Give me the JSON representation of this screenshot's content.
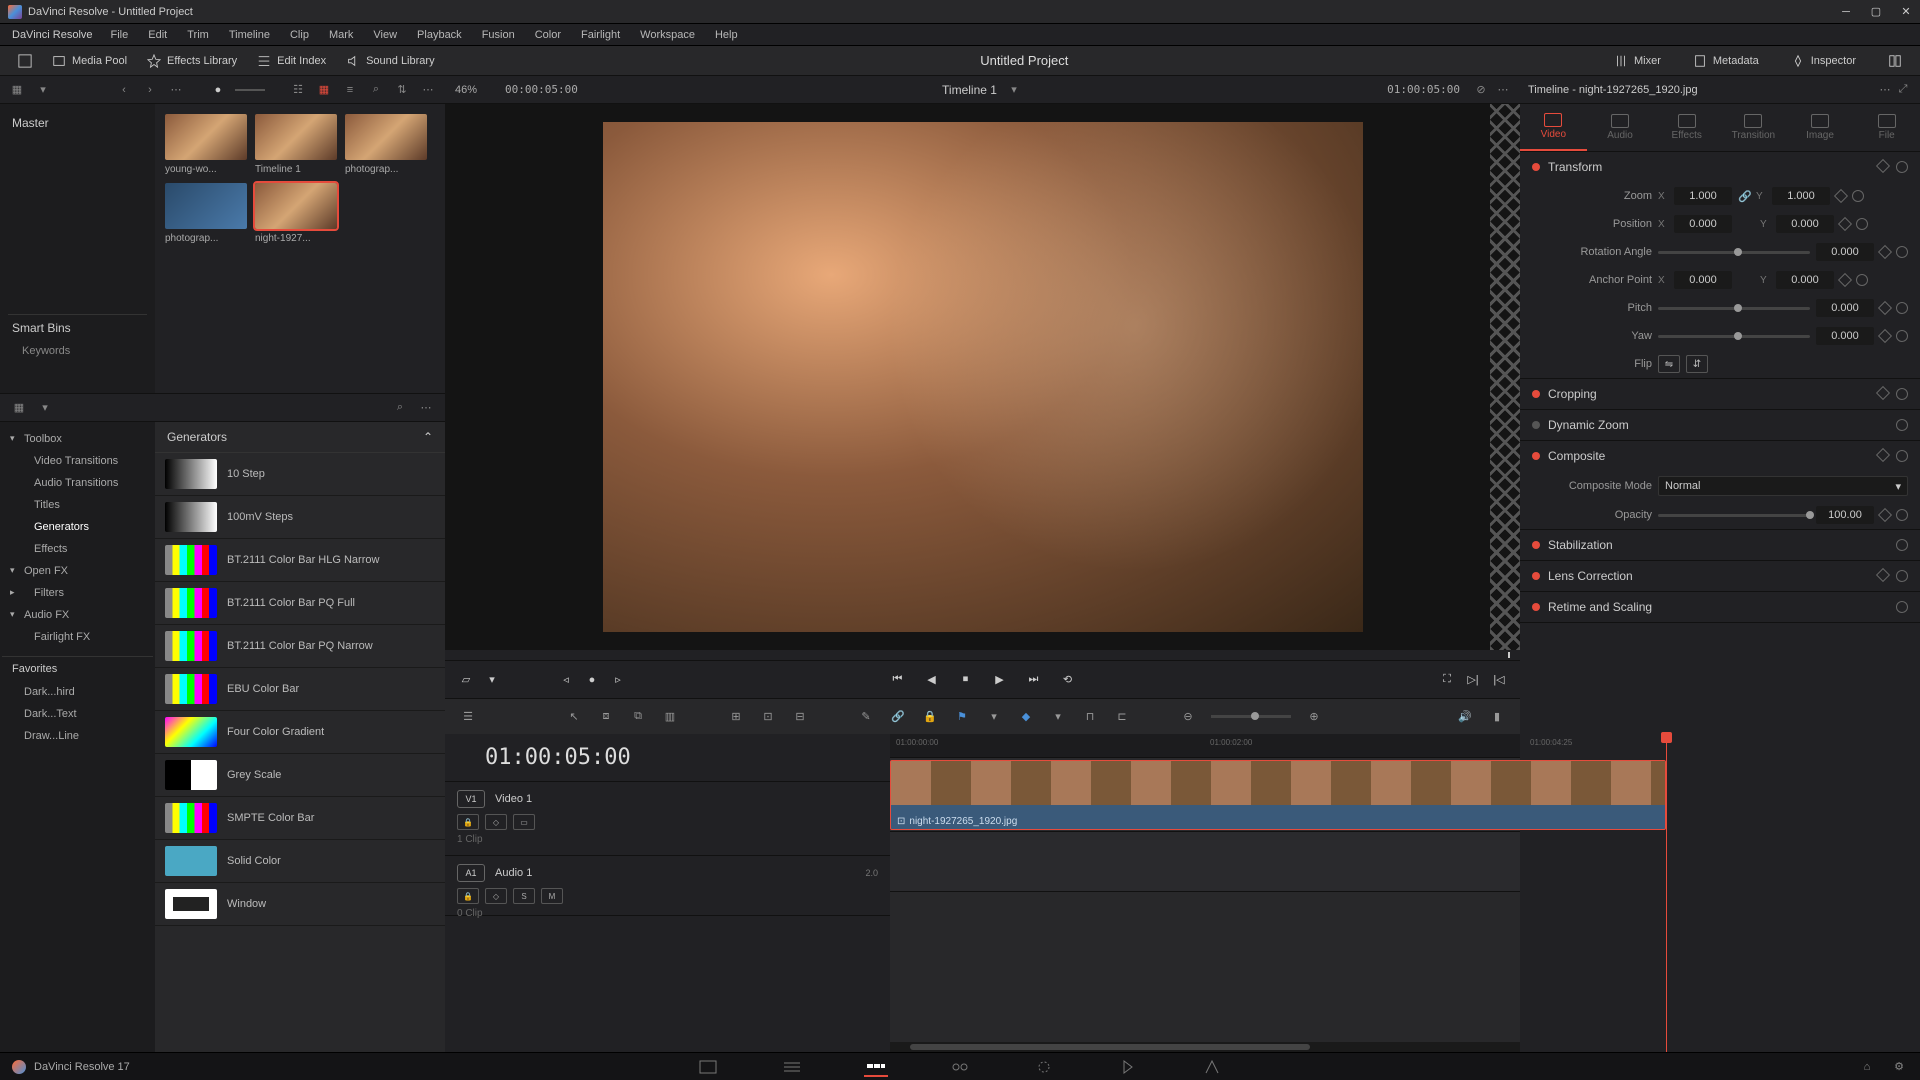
{
  "window": {
    "title": "DaVinci Resolve - Untitled Project"
  },
  "menubar": {
    "logo": "DaVinci Resolve",
    "items": [
      "File",
      "Edit",
      "Trim",
      "Timeline",
      "Clip",
      "Mark",
      "View",
      "Playback",
      "Fusion",
      "Color",
      "Fairlight",
      "Workspace",
      "Help"
    ]
  },
  "toolbar": {
    "media_pool": "Media Pool",
    "effects_library": "Effects Library",
    "edit_index": "Edit Index",
    "sound_library": "Sound Library",
    "project_title": "Untitled Project",
    "mixer": "Mixer",
    "metadata": "Metadata",
    "inspector": "Inspector"
  },
  "subtoolbar": {
    "zoom_pct": "46%",
    "source_tc": "00:00:05:00",
    "timeline_name": "Timeline 1",
    "record_tc": "01:00:05:00",
    "inspector_title": "Timeline - night-1927265_1920.jpg"
  },
  "media": {
    "master": "Master",
    "smart_bins": "Smart Bins",
    "keywords": "Keywords",
    "clips": [
      {
        "label": "young-wo..."
      },
      {
        "label": "Timeline 1"
      },
      {
        "label": "photograp..."
      },
      {
        "label": "photograp..."
      },
      {
        "label": "night-1927...",
        "selected": true
      }
    ]
  },
  "effects": {
    "tree": {
      "toolbox": "Toolbox",
      "video_transitions": "Video Transitions",
      "audio_transitions": "Audio Transitions",
      "titles": "Titles",
      "generators": "Generators",
      "effects": "Effects",
      "open_fx": "Open FX",
      "filters": "Filters",
      "audio_fx": "Audio FX",
      "fairlight_fx": "Fairlight FX"
    },
    "favorites_header": "Favorites",
    "favorites": [
      "Dark...hird",
      "Dark...Text",
      "Draw...Line"
    ],
    "gen_header": "Generators",
    "generators": [
      {
        "name": "10 Step",
        "sw": "sw-step"
      },
      {
        "name": "100mV Steps",
        "sw": "sw-step"
      },
      {
        "name": "BT.2111 Color Bar HLG Narrow",
        "sw": "sw-bars"
      },
      {
        "name": "BT.2111 Color Bar PQ Full",
        "sw": "sw-bars"
      },
      {
        "name": "BT.2111 Color Bar PQ Narrow",
        "sw": "sw-bars"
      },
      {
        "name": "EBU Color Bar",
        "sw": "sw-bars"
      },
      {
        "name": "Four Color Gradient",
        "sw": "sw-grad"
      },
      {
        "name": "Grey Scale",
        "sw": "sw-grey"
      },
      {
        "name": "SMPTE Color Bar",
        "sw": "sw-bars"
      },
      {
        "name": "Solid Color",
        "sw": "sw-solid"
      },
      {
        "name": "Window",
        "sw": "sw-window"
      }
    ]
  },
  "timeline": {
    "tc": "01:00:05:00",
    "ruler": [
      "01:00:00:00",
      "01:00:02:00",
      "01:00:04:25"
    ],
    "v1": {
      "tag": "V1",
      "name": "Video 1",
      "clips": "1 Clip"
    },
    "a1": {
      "tag": "A1",
      "name": "Audio 1",
      "ch": "2.0",
      "clips": "0 Clip"
    },
    "clip_name": "night-1927265_1920.jpg"
  },
  "inspector": {
    "tabs": [
      "Video",
      "Audio",
      "Effects",
      "Transition",
      "Image",
      "File"
    ],
    "transform": {
      "title": "Transform",
      "zoom": "Zoom",
      "zoom_x": "1.000",
      "zoom_y": "1.000",
      "position": "Position",
      "pos_x": "0.000",
      "pos_y": "0.000",
      "rotation": "Rotation Angle",
      "rotation_v": "0.000",
      "anchor": "Anchor Point",
      "anchor_x": "0.000",
      "anchor_y": "0.000",
      "pitch": "Pitch",
      "pitch_v": "0.000",
      "yaw": "Yaw",
      "yaw_v": "0.000",
      "flip": "Flip"
    },
    "cropping": "Cropping",
    "dynamic_zoom": "Dynamic Zoom",
    "composite": {
      "title": "Composite",
      "mode_label": "Composite Mode",
      "mode": "Normal",
      "opacity_label": "Opacity",
      "opacity": "100.00"
    },
    "stabilization": "Stabilization",
    "lens_correction": "Lens Correction",
    "retime": "Retime and Scaling"
  },
  "pagebar": {
    "app": "DaVinci Resolve 17"
  }
}
